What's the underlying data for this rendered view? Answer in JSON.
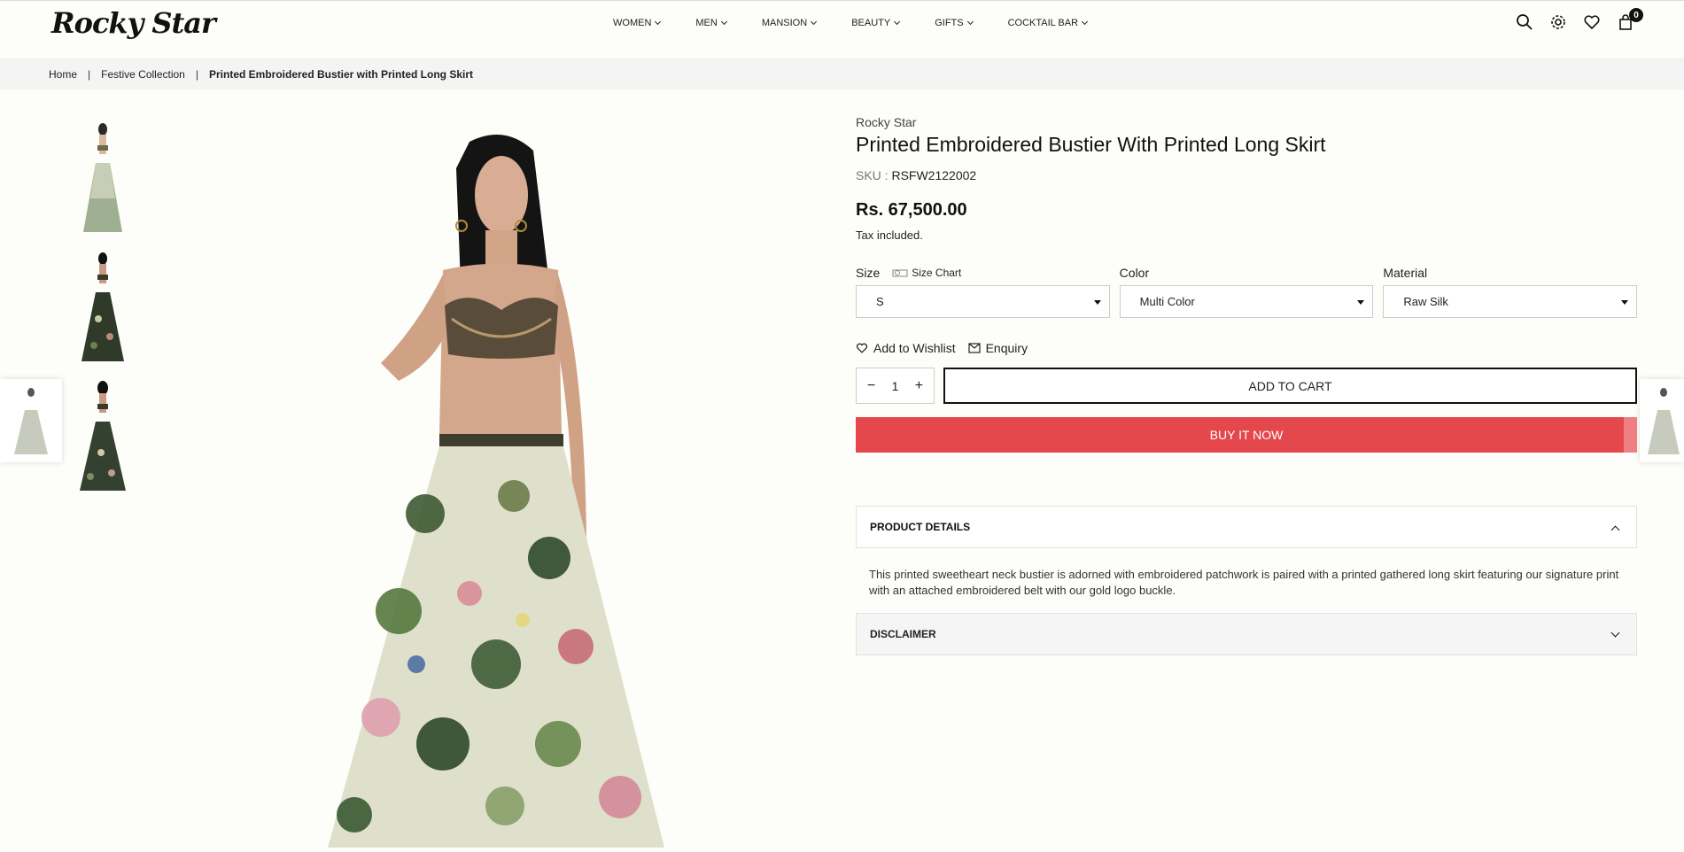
{
  "header": {
    "logo": "Rocky Star",
    "nav": [
      "WOMEN",
      "MEN",
      "MANSION",
      "BEAUTY",
      "GIFTS",
      "COCKTAIL BAR"
    ],
    "icons": [
      "search-icon",
      "gear-icon",
      "heart-icon",
      "bag-icon"
    ],
    "cart_count": "0"
  },
  "breadcrumb": {
    "items": [
      "Home",
      "Festive Collection",
      "Printed Embroidered Bustier with Printed Long Skirt"
    ],
    "separator": "|"
  },
  "product": {
    "vendor": "Rocky Star",
    "title": "Printed Embroidered Bustier With Printed Long Skirt",
    "sku_label": "SKU :",
    "sku": "RSFW2122002",
    "price": "Rs. 67,500.00",
    "tax_note": "Tax included.",
    "options": {
      "size_label": "Size",
      "size_chart": "Size Chart",
      "size_value": "S",
      "color_label": "Color",
      "color_value": "Multi Color",
      "material_label": "Material",
      "material_value": "Raw Silk"
    },
    "wishlist": "Add to Wishlist",
    "enquiry": "Enquiry",
    "quantity": "1",
    "minus": "−",
    "plus": "+",
    "add_to_cart": "ADD TO CART",
    "buy_now": "BUY IT NOW",
    "details_title": "PRODUCT DETAILS",
    "details_text": "This printed sweetheart neck bustier is adorned with embroidered patchwork is paired with a printed gathered long skirt featuring our signature print with an attached embroidered belt with our gold logo buckle.",
    "disclaimer_title": "DISCLAIMER"
  },
  "colors": {
    "buy_now": "#e4484d",
    "background": "#fdfdf9",
    "breadcrumb_bg": "#f4f4f4"
  }
}
